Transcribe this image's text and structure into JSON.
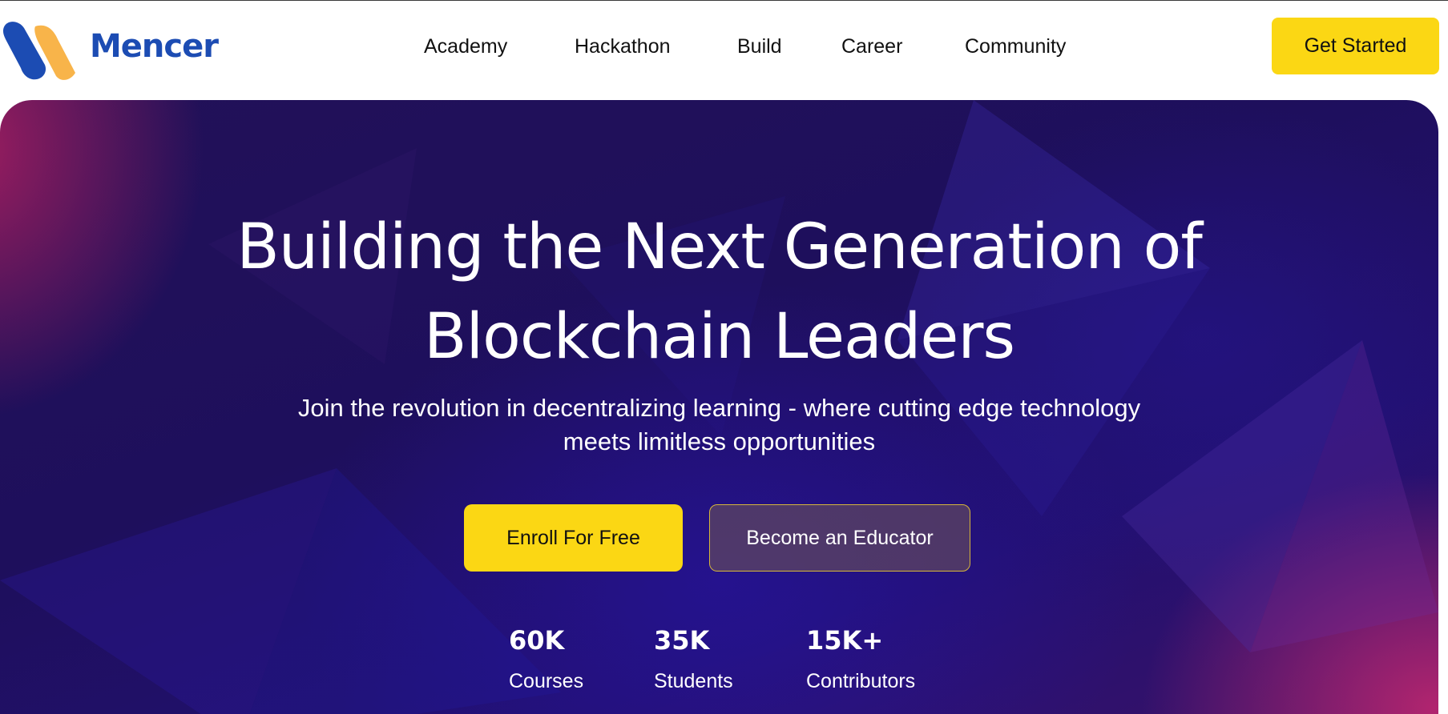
{
  "header": {
    "logo_text": "Mencer",
    "nav": [
      {
        "label": "Academy"
      },
      {
        "label": "Hackathon"
      },
      {
        "label": "Build"
      },
      {
        "label": "Career"
      },
      {
        "label": "Community"
      }
    ],
    "cta_label": "Get Started"
  },
  "hero": {
    "title_lines": [
      "Building the Next Generation of",
      "Blockchain Leaders"
    ],
    "subtitle_lines": [
      "Join the revolution in decentralizing learning - where cutting edge technology",
      "meets limitless opportunities"
    ],
    "primary_button": "Enroll For Free",
    "secondary_button": "Become an Educator",
    "stats": [
      {
        "value": "60K",
        "label": "Courses"
      },
      {
        "value": "35K",
        "label": "Students"
      },
      {
        "value": "15K+",
        "label": "Contributors"
      }
    ]
  },
  "colors": {
    "brand_blue": "#1c4cb3",
    "brand_orange": "#f8b44a",
    "accent_yellow": "#fbd714",
    "hero_base": "#1e0f5c",
    "hero_magenta": "#c62870"
  },
  "icons": {
    "logo_mark": "mencer-logo-mark-icon"
  }
}
